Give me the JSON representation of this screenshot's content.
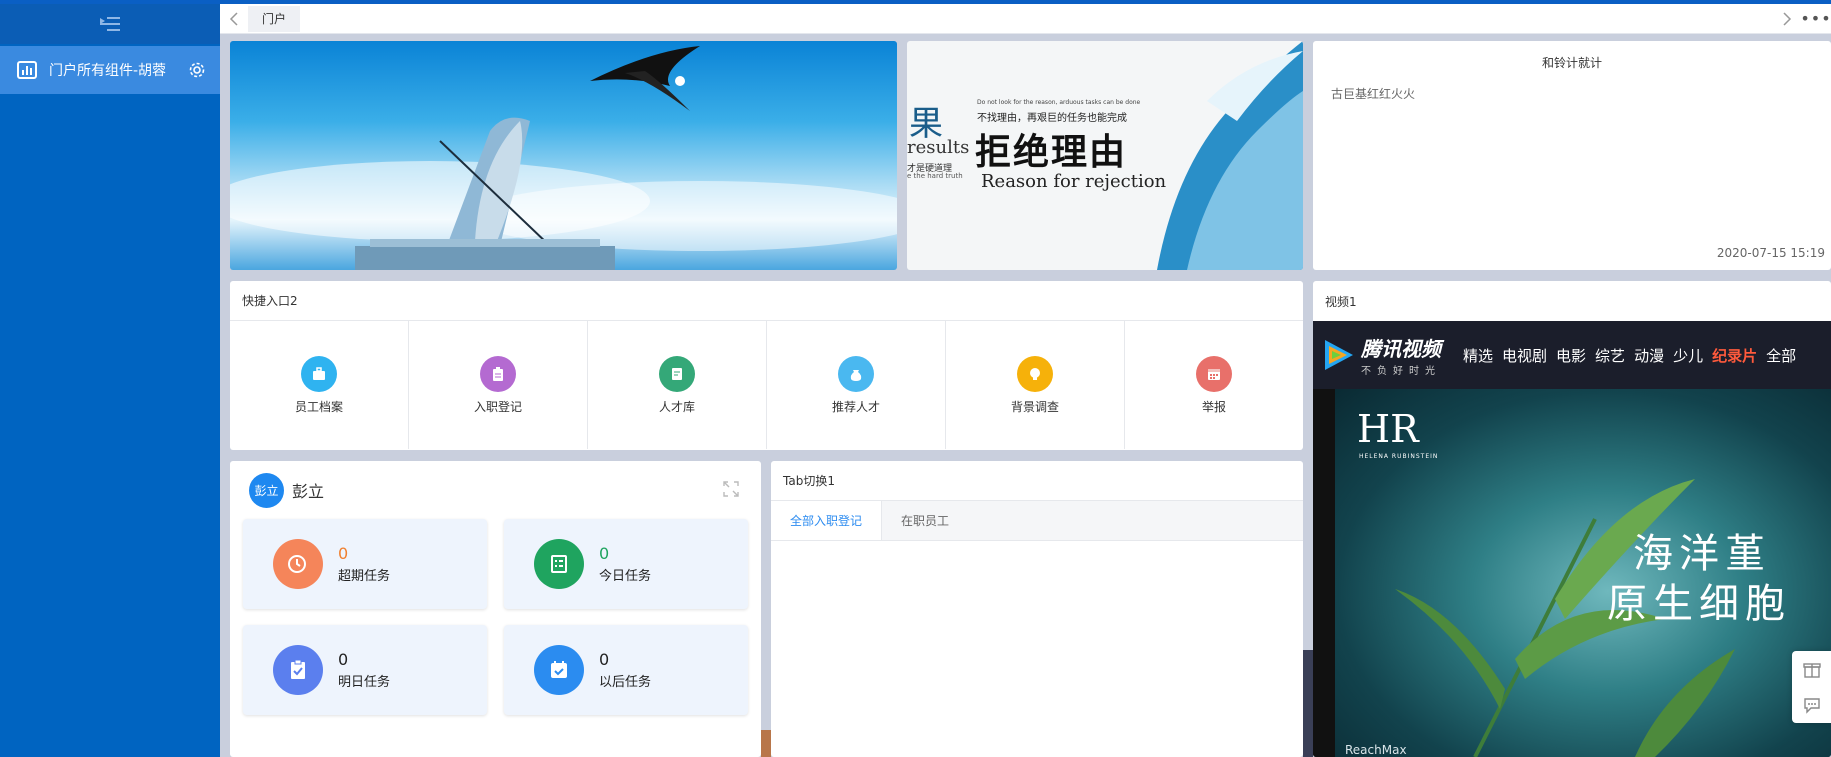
{
  "sidebar": {
    "menu_item": "门户所有组件-胡蓉"
  },
  "tabbar": {
    "active_tab": "门户",
    "more": "•••"
  },
  "banner2": {
    "fruit": "果",
    "results": "results",
    "small1": "才是硬道理",
    "small2": "e the hard truth",
    "en_line": "Do not look for the reason, arduous tasks can be done",
    "cn_line": "不找理由，再艰巨的任务也能完成",
    "big": "拒绝理由",
    "reason": "Reason for rejection"
  },
  "text_widget": {
    "title": "和铃计就计",
    "body": "古巨基红红火火",
    "date": "2020-07-15 15:19"
  },
  "quick": {
    "title": "快捷入口2",
    "items": [
      {
        "label": "员工档案",
        "color": "#2fb3f0",
        "icon": "briefcase-icon"
      },
      {
        "label": "入职登记",
        "color": "#b46ad1",
        "icon": "clipboard-icon"
      },
      {
        "label": "人才库",
        "color": "#34a878",
        "icon": "document-icon"
      },
      {
        "label": "推荐人才",
        "color": "#4ab8f0",
        "icon": "money-bag-icon"
      },
      {
        "label": "背景调查",
        "color": "#f6b10a",
        "icon": "lightbulb-icon"
      },
      {
        "label": "举报",
        "color": "#e8706a",
        "icon": "calendar-icon"
      }
    ]
  },
  "video": {
    "title": "视频1",
    "brand": "腾讯视频",
    "slogan": "不负好时光",
    "nav": [
      "精选",
      "电视剧",
      "电影",
      "综艺",
      "动漫",
      "少儿",
      "纪录片",
      "全部"
    ],
    "hr": "HR",
    "hr_sub": "HELENA RUBINSTEIN",
    "caption1": "海洋堇",
    "caption2": "原生细胞",
    "reach": "ReachMax"
  },
  "tasks": {
    "avatar": "彭立",
    "user": "彭立",
    "items": [
      {
        "num": "0",
        "label": "超期任务",
        "color": "#f5855a",
        "numcolor": "#f08030"
      },
      {
        "num": "0",
        "label": "今日任务",
        "color": "#1fa45f",
        "numcolor": "#1fa45f"
      },
      {
        "num": "0",
        "label": "明日任务",
        "color": "#5b7fee",
        "numcolor": "#222222"
      },
      {
        "num": "0",
        "label": "以后任务",
        "color": "#2b8cf0",
        "numcolor": "#222222"
      }
    ]
  },
  "tabswitch": {
    "title": "Tab切换1",
    "tabs": [
      "全部入职登记",
      "在职员工"
    ]
  }
}
